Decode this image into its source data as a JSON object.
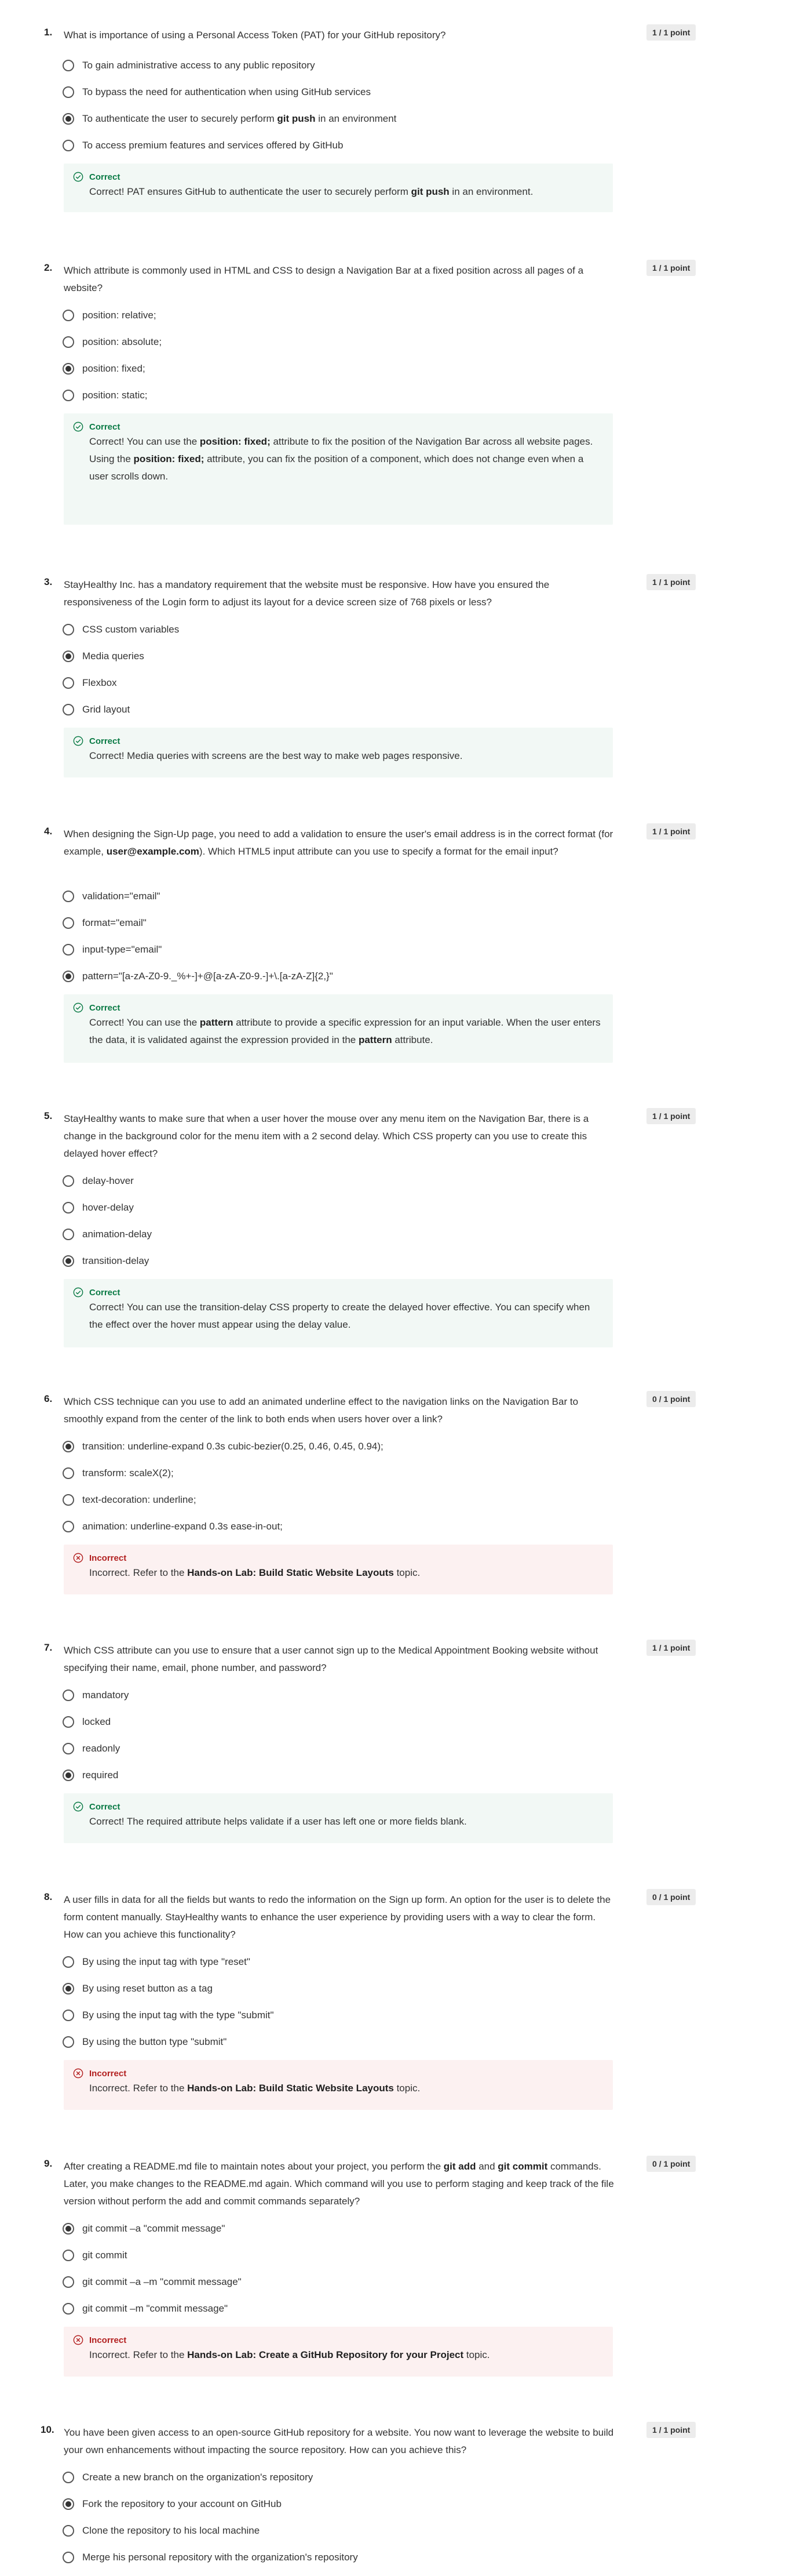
{
  "labels": {
    "correct": "Correct",
    "incorrect": "Incorrect"
  },
  "colors": {
    "correct": "#0a7a45",
    "incorrect": "#b21f1f",
    "correct_bg": "#f2f8f5",
    "incorrect_bg": "#fcf1f1"
  },
  "questions": [
    {
      "number": "1.",
      "text": "What is importance of using a Personal Access Token (PAT) for your GitHub repository?",
      "score": "1 / 1 point",
      "options": [
        "To gain administrative access to any public repository",
        "To bypass the need for authentication when using GitHub services",
        "To authenticate the user to securely perform git push in an environment",
        "To access premium features and services offered by GitHub"
      ],
      "selected": 2,
      "result": "correct",
      "feedback": "Correct! PAT ensures GitHub to authenticate the user to securely perform git push in an environment."
    },
    {
      "number": "2.",
      "text": "Which attribute is commonly used in HTML and CSS to design a Navigation Bar at a fixed position across all pages of a website?",
      "score": "1 / 1 point",
      "options": [
        "position: relative;",
        "position: absolute;",
        "position: fixed;",
        "position: static;"
      ],
      "selected": 2,
      "result": "correct",
      "feedback": "Correct! You can use the position: fixed; attribute to fix the position of the Navigation Bar across all website pages. Using the position: fixed; attribute, you can fix the position of a component, which does not change even when a user scrolls down."
    },
    {
      "number": "3.",
      "text": "StayHealthy Inc. has a mandatory requirement that the website must be responsive. How have you ensured the responsiveness of the Login form to adjust its layout for a device screen size of 768 pixels or less?",
      "score": "1 / 1 point",
      "options": [
        "CSS custom variables",
        "Media queries",
        "Flexbox",
        "Grid layout"
      ],
      "selected": 1,
      "result": "correct",
      "feedback": "Correct! Media queries with screens are the best way to make web pages responsive."
    },
    {
      "number": "4.",
      "text": "When designing the Sign-Up page, you need to add a validation to ensure the user's email address is in the correct format (for example, user@example.com). Which HTML5 input attribute can you use to specify a format for the email input?",
      "score": "1 / 1 point",
      "options": [
        "validation=\"email\"",
        "format=\"email\"",
        "input-type=\"email\"",
        "pattern=\"[a-zA-Z0-9._%+-]+@[a-zA-Z0-9.-]+\\.[a-zA-Z]{2,}\""
      ],
      "selected": 3,
      "result": "correct",
      "feedback": "Correct! You can use the pattern attribute to provide a specific expression for an input variable. When the user enters the data, it is validated against the expression provided in the pattern attribute."
    },
    {
      "number": "5.",
      "text": "StayHealthy wants to make sure that when a user hover the mouse over any menu item on the Navigation Bar, there is a change in the background color for the menu item with a 2 second delay. Which CSS property can you use to create this delayed hover effect?",
      "score": "1 / 1 point",
      "options": [
        "delay-hover",
        "hover-delay",
        "animation-delay",
        "transition-delay"
      ],
      "selected": 3,
      "result": "correct",
      "feedback": "Correct! You can use the transition-delay CSS property to create the delayed hover effective.  You can specify when the effect over the hover must appear using the delay value."
    },
    {
      "number": "6.",
      "text": "Which CSS technique can you use to add an animated underline effect to the navigation links on the Navigation Bar to smoothly expand from the center of the link to both ends when users hover over a link?",
      "score": "0 / 1 point",
      "options": [
        "transition: underline-expand 0.3s cubic-bezier(0.25, 0.46, 0.45, 0.94);",
        "transform: scaleX(2);",
        "text-decoration: underline;",
        "animation: underline-expand 0.3s ease-in-out;"
      ],
      "selected": 0,
      "result": "incorrect",
      "feedback": "Incorrect. Refer to the Hands-on Lab: Build Static Website Layouts topic."
    },
    {
      "number": "7.",
      "text": "Which CSS attribute can you use to ensure that a user cannot sign up to the Medical Appointment Booking website without specifying their name, email, phone number, and password?",
      "score": "1 / 1 point",
      "options": [
        "mandatory",
        "locked",
        "readonly",
        "required"
      ],
      "selected": 3,
      "result": "correct",
      "feedback": "Correct! The required attribute helps validate if a user has left one or more fields blank."
    },
    {
      "number": "8.",
      "text": "A user fills in data for all the fields but wants to redo the information on the Sign up form.  An option for the user is to delete the form content manually. StayHealthy wants to enhance the user experience by providing users with a way to clear the form. How can you achieve this functionality?",
      "score": "0 / 1 point",
      "options": [
        "By using the input tag with type \"reset\"",
        "By using reset button as a tag",
        "By using the input tag with the type \"submit\"",
        "By using the button type \"submit\""
      ],
      "selected": 1,
      "result": "incorrect",
      "feedback": "Incorrect. Refer to the Hands-on Lab: Build Static Website Layouts topic."
    },
    {
      "number": "9.",
      "text": "After creating a README.md file to maintain notes about your project, you perform the git add and git commit commands. Later, you make changes to the README.md again. Which command will you use to perform staging and keep track of the file version without perform the add and commit commands separately?",
      "score": "0 / 1 point",
      "options": [
        "git commit –a \"commit message\"",
        "git commit",
        "git commit –a –m \"commit message\"",
        "git commit –m \"commit message\""
      ],
      "selected": 0,
      "result": "incorrect",
      "feedback": "Incorrect. Refer to the Hands-on Lab: Create a GitHub Repository for your Project topic."
    },
    {
      "number": "10.",
      "text": "You have been given access to an open-source GitHub repository for a website. You now want to leverage the website to build your own enhancements without impacting the source repository. How can you achieve this?",
      "score": "1 / 1 point",
      "options": [
        "Create a new branch on the organization's repository",
        "Fork the repository to your account on GitHub",
        "Clone the repository to his local machine",
        "Merge his personal repository with the organization's repository"
      ],
      "selected": 1,
      "result": null,
      "feedback": null
    }
  ]
}
